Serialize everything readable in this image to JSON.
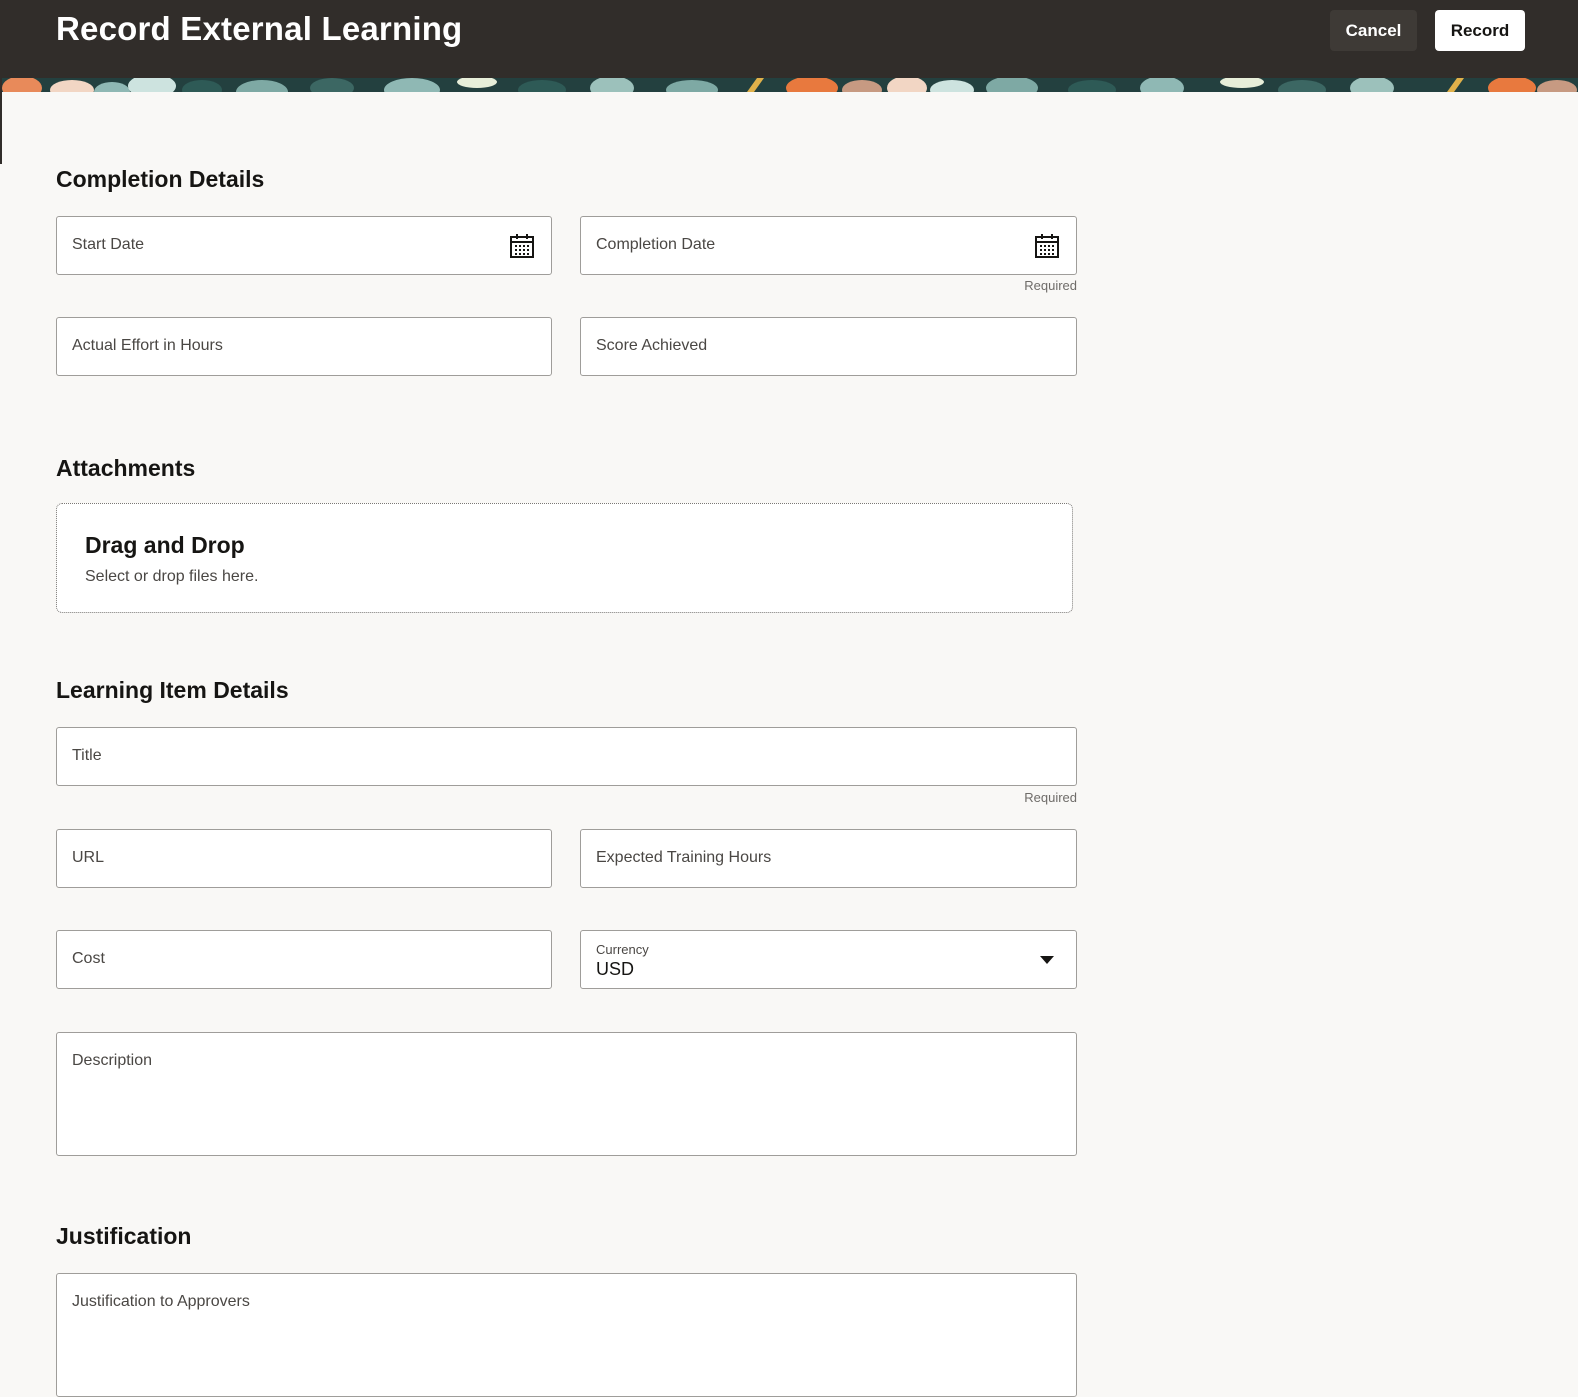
{
  "header": {
    "title": "Record External Learning",
    "cancel_label": "Cancel",
    "record_label": "Record"
  },
  "completion": {
    "title": "Completion Details",
    "start_date": "Start Date",
    "completion_date": "Completion Date",
    "completion_required": "Required",
    "effort": "Actual Effort in Hours",
    "score": "Score Achieved"
  },
  "attachments": {
    "title": "Attachments",
    "drop_title": "Drag and Drop",
    "drop_sub": "Select or drop files here."
  },
  "learning_item": {
    "title": "Learning Item Details",
    "title_field": "Title",
    "title_required": "Required",
    "url": "URL",
    "expected_hours": "Expected Training Hours",
    "cost": "Cost",
    "currency_label": "Currency",
    "currency_value": "USD",
    "description": "Description"
  },
  "justification": {
    "title": "Justification",
    "field": "Justification to Approvers"
  },
  "icons": {
    "calendar": "calendar-icon",
    "dropdown": "chevron-down-icon"
  },
  "colors": {
    "header_bg": "#312d2a",
    "page_bg": "#f9f8f6",
    "field_border": "#9f9d9a"
  }
}
